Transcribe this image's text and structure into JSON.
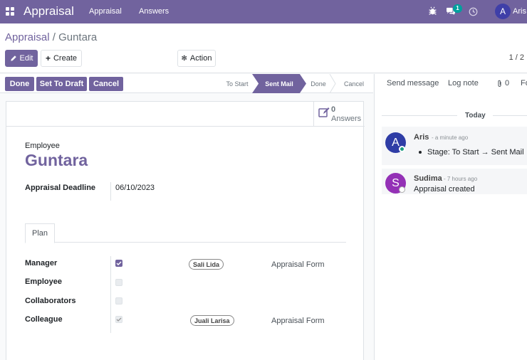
{
  "topnav": {
    "brand": "Appraisal",
    "menu": [
      "Appraisal",
      "Answers"
    ],
    "chat_count": "1",
    "user_initial": "A",
    "user_name": "Aris"
  },
  "control": {
    "breadcrumb_parent": "Appraisal",
    "breadcrumb_sep": " / ",
    "breadcrumb_current": "Guntara",
    "edit_label": "Edit",
    "create_label": "Create",
    "action_label": "Action",
    "pager": "1 / 2"
  },
  "statusbar": {
    "buttons": [
      "Done",
      "Set To Draft",
      "Cancel"
    ],
    "stages": [
      "To Start",
      "Sent Mail",
      "Done",
      "Cancel"
    ],
    "active_stage": "Sent Mail"
  },
  "form": {
    "stat_value": "0",
    "stat_label": "Answers",
    "employee_label": "Employee",
    "employee_name": "Guntara",
    "deadline_label": "Appraisal Deadline",
    "deadline_value": "06/10/2023",
    "tab_label": "Plan",
    "plan_rows": [
      {
        "label": "Manager",
        "checked": true,
        "tag": "Sali Lida",
        "form": "Appraisal Form"
      },
      {
        "label": "Employee",
        "checked": false,
        "tag": "",
        "form": ""
      },
      {
        "label": "Collaborators",
        "checked": false,
        "tag": "",
        "form": ""
      },
      {
        "label": "Colleague",
        "checked": true,
        "tag": "Juali Larisa",
        "form": "Appraisal Form"
      }
    ]
  },
  "chatter": {
    "send_message": "Send message",
    "log_note": "Log note",
    "attachments": "0",
    "follow_label": "Fo",
    "day_label": "Today",
    "messages": [
      {
        "initial": "A",
        "author": "Aris",
        "time": "- a minute ago",
        "body": "Stage: To Start → Sent Mail",
        "avatar_color": "#2f3da6"
      },
      {
        "initial": "S",
        "author": "Sudima",
        "time": "- 7 hours ago",
        "body": "Appraisal created",
        "avatar_color": "#9431b6"
      }
    ]
  },
  "colors": {
    "primary": "#71639e",
    "badge": "#00a09d"
  }
}
